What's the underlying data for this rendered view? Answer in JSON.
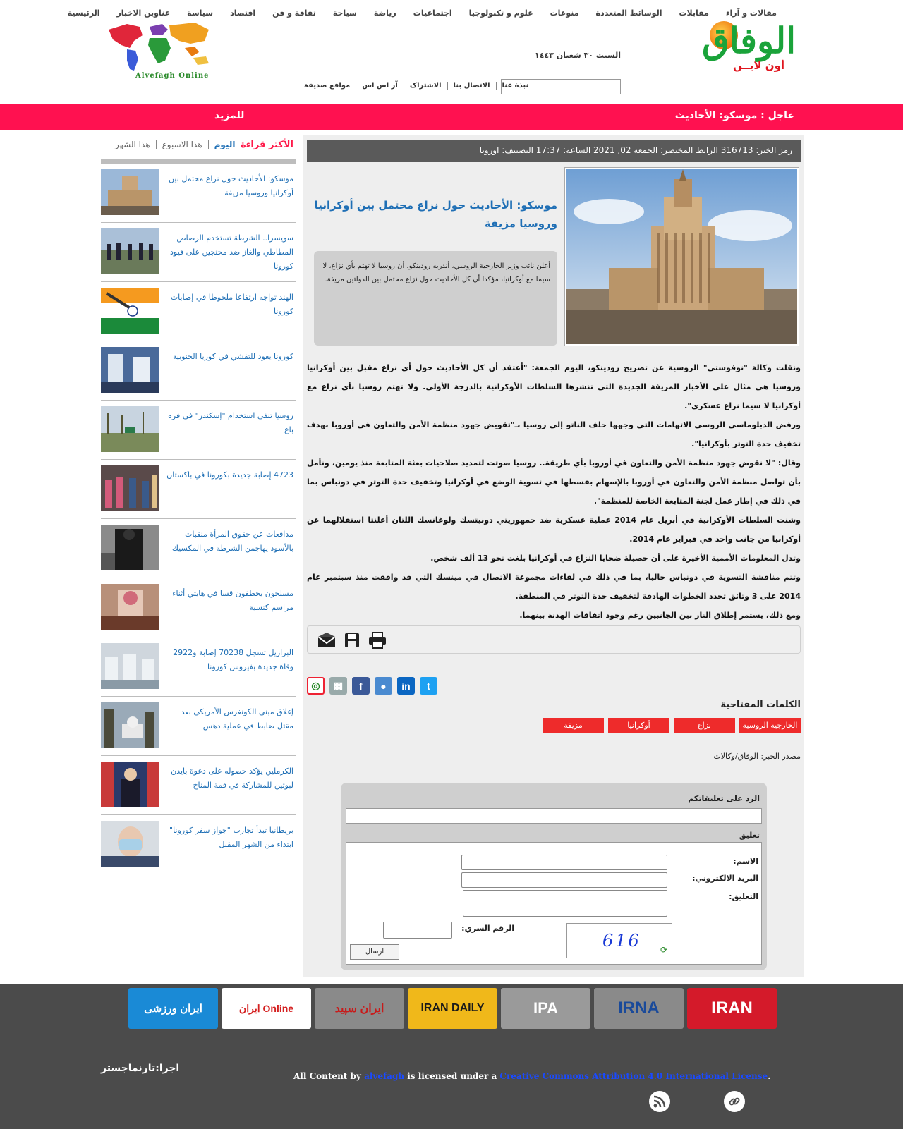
{
  "header": {
    "nav": [
      "الرئيسية",
      "عناوين الاخبار",
      "سياسة",
      "اقتصاد",
      "ثقافة و فن",
      "سياحة",
      "رياضة",
      "اجتماعيات",
      "علوم و تكنولوجيا",
      "منوعات",
      "الوسائط المتعددة",
      "مقابلات",
      "مقالات و آراء"
    ],
    "brand": "الوفاق",
    "brand_sub": "أون لايــن",
    "date": "السبت ٣٠ شعبان ١٤٤٣",
    "sublinks": [
      "نبذة عنا",
      "الاتصال بنا",
      "الاشتراک",
      "آر اس اس",
      "مواقع صديقة"
    ],
    "left_logo_text": "Alvefagh Online"
  },
  "breaking": {
    "text": "عاجل :  موسكو: الأحاديث",
    "more": "للمزيد"
  },
  "article": {
    "infobar": "رمز الخبر: 316713     الرابط المختصر: الجمعة 02, 2021    الساعة: 17:37    التصنيف: اوروبا",
    "title": "موسكو: الأحاديث حول نزاع محتمل بين أوكرانيا وروسيا مزيفة",
    "lead": "أعلن نائب وزير الخارجية الروسي، أندريه رودينكو، أن روسيا لا تهتم بأي نزاع، لا سيما مع أوكرانيا، مؤكدا أن كل الأحاديث حول نزاع محتمل بين الدولتين مزيفة.",
    "body": [
      "ونقلت وكالة \"نوفوستي\" الروسية عن تصريح رودينكو، اليوم الجمعة: \"أعتقد أن كل الأحاديث حول أي نزاع مقبل بين أوكرانيا وروسيا هي مثال على الأخبار المزيفة الجديدة التي تنشرها السلطات الأوكرانية بالدرجة الأولى. ولا تهتم روسيا بأي نزاع مع أوكرانيا لا سيما نزاع عسكري\".",
      "ورفض الدبلوماسي الروسي الاتهامات التي وجهها حلف الناتو إلى روسيا بـ\"تقويض جهود منظمة الأمن والتعاون في أوروبا بهدف تخفيف حدة التوتر بأوكرانيا\".",
      "وقال: \"لا نقوض جهود منظمة الأمن والتعاون في أوروبا بأي طريقة.. روسيا صوتت لتمديد صلاحيات بعثة المتابعة منذ يومين، ونأمل بأن تواصل منظمة الأمن والتعاون في أوروبا بالإسهام بقسطها في تسوية الوضع في أوكرانيا وتخفيف حدة التوتر في دونباس بما في ذلك في إطار عمل لجنة المتابعة الخاصة للمنظمة\".",
      "وشنت السلطات الأوكرانية في أبريل عام 2014 عملية عسكرية ضد جمهوريتي دونيتسك ولوغانسك اللتان أعلنتا استقلالهما عن أوكرانيا من جانب واحد في فبراير عام 2014.",
      "وتدل المعلومات الأممية الأخيرة على أن حصيلة ضحايا النزاع في أوكرانيا بلغت نحو 13 ألف شخص.",
      "وتتم مناقشة التسوية في دونباس حاليا، بما في ذلك في لقاءات مجموعة الاتصال في مينسك التي قد وافقت منذ سبتمبر عام 2014 على 3 وثائق تحدد الخطوات الهادفة لتخفيف حدة التوتر في المنطقة.",
      "ومع ذلك، يستمر إطلاق النار بين الجانبين رغم وجود اتفاقات الهدنة بينهما."
    ],
    "keywords_title": "الكلمات المفتاحية",
    "keywords": [
      "الخارجية الروسية",
      "نزاع",
      "أوكرانيا",
      "مزيفة"
    ],
    "source": "مصدر الخبر: الوفاق/وكالات"
  },
  "comment_form": {
    "reply_label": "الرد على تعليقاتكم",
    "comment_label": "تعليق",
    "name_label": "الاسم:",
    "email_label": "البريد الالكتروني:",
    "comment_field_label": "التعليق:",
    "captcha_label": "الرقم السري:",
    "captcha_code": "616",
    "submit": "ارسال"
  },
  "sidebar": {
    "most_read": "الأكثر قراءة",
    "tabs": [
      "اليوم",
      "هذا الاسبوع",
      "هذا الشهر"
    ],
    "items": [
      {
        "title": "موسكو: الأحاديث حول نزاع محتمل بين أوكرانيا وروسيا مزيفة"
      },
      {
        "title": "سويسرا.. الشرطة تستخدم الرصاص المطاطي والغاز ضد محتجين على قيود كورونا"
      },
      {
        "title": "الهند تواجه ارتفاعا ملحوظا في إصابات كورونا"
      },
      {
        "title": "كورونا يعود للتفشي في كوريا الجنوبية"
      },
      {
        "title": "روسيا تنفي استخدام \"إسكندر\" في فره باغ"
      },
      {
        "title": "4723 إصابة جديدة بكورونا في باكستان"
      },
      {
        "title": "مدافعات عن حقوق المرأة منقبات بالأسود يهاجمن الشرطة في المكسيك"
      },
      {
        "title": "مسلحون يخطفون قسا في هايتي أثناء مراسم كنسية"
      },
      {
        "title": "البرازيل تسجل 70238 إصابة و2922 وفاة جديدة بفيروس كورونا"
      },
      {
        "title": "إغلاق مبنى الكونغرس الأمريكي بعد مقتل ضابط في عملية دهس"
      },
      {
        "title": "الكرملين يؤكد حصوله على دعوة بايدن لبوتين للمشاركة في قمة المناخ"
      },
      {
        "title": "بريطانيا تبدأ تجارب \"جواز سفر كورونا\" ابتداء من الشهر المقبل"
      }
    ]
  },
  "footer": {
    "partners": [
      "IRAN",
      "IRNA",
      "IPA",
      "IRAN DAILY",
      "ایران سپید",
      "ایران Online",
      "ایران ورزشی"
    ],
    "credit": "اجرا:تارنماجستر",
    "license_prefix": "All Content by ",
    "license_owner": "alvefagh",
    "license_mid": " is licensed under a ",
    "license_name": "Creative Commons Attribution 4.0 International License",
    "license_suffix": "."
  },
  "colors": {
    "breaking_bar": "#ff1150",
    "link_blue": "#1f6fb5",
    "keyword_red": "#ee2b2b",
    "footer_bg": "#4b4b4b"
  }
}
